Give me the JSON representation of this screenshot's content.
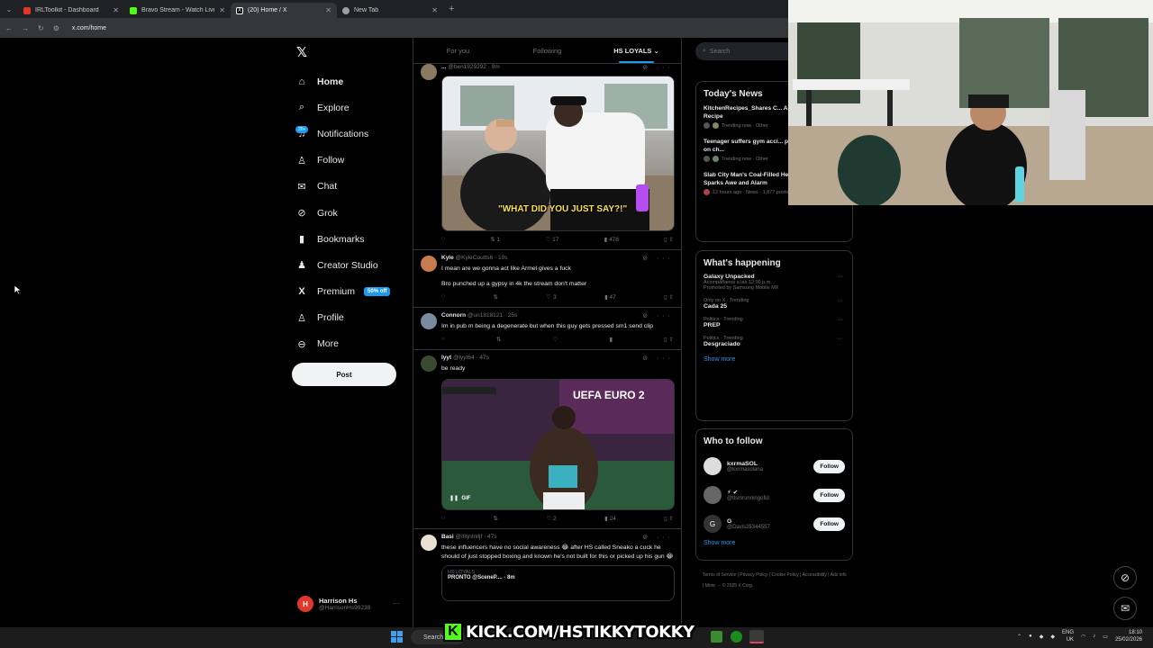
{
  "browser": {
    "tabs": [
      {
        "title": "IRLToolkit - Dashboard",
        "color": "#e0362c"
      },
      {
        "title": "Bravo Stream - Watch Live on",
        "color": "#53fc18"
      },
      {
        "title": "(20) Home / X",
        "color": "#ffffff",
        "active": true
      },
      {
        "title": "New Tab",
        "color": "#9aa0a6"
      }
    ],
    "url": "x.com/home"
  },
  "nav": {
    "items": [
      {
        "label": "Home",
        "icon": "⌂",
        "bold": true
      },
      {
        "label": "Explore",
        "icon": "⌕"
      },
      {
        "label": "Notifications",
        "icon": "♫",
        "badge": "20+"
      },
      {
        "label": "Follow",
        "icon": "♙"
      },
      {
        "label": "Chat",
        "icon": "✉"
      },
      {
        "label": "Grok",
        "icon": "⊘"
      },
      {
        "label": "Bookmarks",
        "icon": "▮"
      },
      {
        "label": "Creator Studio",
        "icon": "♟"
      },
      {
        "label": "Premium",
        "icon": "X",
        "promo": "50% off"
      },
      {
        "label": "Profile",
        "icon": "♙"
      },
      {
        "label": "More",
        "icon": "⊖"
      }
    ],
    "post_label": "Post",
    "profile_name": "Harrison Hs",
    "profile_handle": "@HarrisonHs99238"
  },
  "timeline": {
    "tabs": [
      "For you",
      "Following",
      "HS LOYALS ⌄"
    ],
    "tweets": [
      {
        "name": "...",
        "handle": "@ben1929292 · 9m",
        "text": "",
        "caption": "\"WHAT DID YOU JUST SAY?!\"",
        "actions": [
          "",
          "1",
          "17",
          "478"
        ]
      },
      {
        "name": "Kyle",
        "handle": "@KyleCoutts6 · 10s",
        "text": "I mean are we gonna act like Armel gives a fuck",
        "text2": "Bro punched up a gypsy in 4k the stream don't matter",
        "actions": [
          "",
          "",
          "3",
          "47"
        ]
      },
      {
        "name": "Connorn",
        "handle": "@un1818121 · 25s",
        "text": "Im in pub m being a degenerate but when this guy gets pressed sm1 send clip",
        "actions": [
          "",
          "",
          "",
          ""
        ]
      },
      {
        "name": "Iyyt",
        "handle": "@lyyt64 · 47s",
        "text": "be ready",
        "media_label": "UEFA EURO 2",
        "gif": "GIF",
        "actions": [
          "",
          "",
          "2",
          "24"
        ]
      },
      {
        "name": "Basi",
        "handle": "@ifitjntnlljf · 47s",
        "text": "these influencers have no social awareness 😂 after HS called Sneako a cuck he should of just stopped boxing and known he's not built for this or picked up his gun 😂",
        "quote_label": "HS LOYALS",
        "quote_text": "PRONTO @SceneP.... · 8m"
      }
    ]
  },
  "sidebar": {
    "search_placeholder": "Search",
    "news_title": "Today's News",
    "news": [
      {
        "title": "KitchenRecipes_Shares C... American Pancake Recipe",
        "meta": "Trending now · Other"
      },
      {
        "title": "Teenager suffers gym acci... pound barbell drops on ch...",
        "meta": "Trending now · Other"
      },
      {
        "title": "Slab City Man's Coal-Filled Heated Mattress Sparks Awe and Alarm",
        "meta": "12 hours ago · News · 1,877 posts"
      }
    ],
    "happening_title": "What's happening",
    "trends": [
      {
        "ctx": "",
        "name": "Galaxy Unpacked",
        "sub": "Acompáñanos a las 12:00 p.m.",
        "sub2": "Promoted by Samsung Mobile MX"
      },
      {
        "ctx": "Only on X · Trending",
        "name": "Cada 25",
        "sub": ""
      },
      {
        "ctx": "Politics · Trending",
        "name": "PREP",
        "sub": ""
      },
      {
        "ctx": "Politics · Trending",
        "name": "Desgraciado",
        "sub": ""
      }
    ],
    "show_more": "Show more",
    "wtf_title": "Who to follow",
    "wtf": [
      {
        "name": "kxrmaSOL",
        "handle": "@kxrmasolana",
        "initial": ""
      },
      {
        "name": "⚡ ✔",
        "handle": "@tlsmrunningofid",
        "initial": ""
      },
      {
        "name": "G",
        "handle": "@Davis25344557",
        "initial": "G"
      }
    ],
    "follow_label": "Follow",
    "footer": "Terms of Service | Privacy Policy | Cookie Policy | Accessibility | Ads info | More ··· © 2025 X Corp."
  },
  "overlay": {
    "kick_logo": "K",
    "kick_text": "KICK.COM/HSTIKKYTOKKY"
  },
  "taskbar": {
    "search": "Search",
    "lang": "ENG",
    "lang2": "UK",
    "time": "18:10",
    "date": "25/02/2026"
  }
}
